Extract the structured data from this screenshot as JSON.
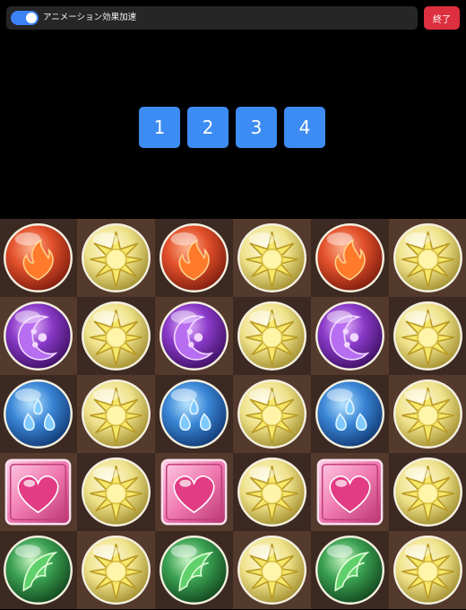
{
  "topbar": {
    "animation_toggle_label": "アニメーション効果加速",
    "animation_toggle_on": true,
    "end_button_label": "終了"
  },
  "combo_buttons": [
    "1",
    "2",
    "3",
    "4"
  ],
  "board": {
    "rows": 5,
    "cols": 6,
    "cell_colors": [
      "#3c2a22",
      "#54392d"
    ],
    "orbs": [
      [
        "fire",
        "light",
        "fire",
        "light",
        "fire",
        "light"
      ],
      [
        "dark",
        "light",
        "dark",
        "light",
        "dark",
        "light"
      ],
      [
        "water",
        "light",
        "water",
        "light",
        "water",
        "light"
      ],
      [
        "heart",
        "light",
        "heart",
        "light",
        "heart",
        "light"
      ],
      [
        "wood",
        "light",
        "wood",
        "light",
        "wood",
        "light"
      ]
    ]
  },
  "colors": {
    "accent_blue": "#3d8cf3",
    "end_red": "#dc2f3f",
    "fire": "#e2502b",
    "light": "#e8d85a",
    "dark": "#8a3ac8",
    "water": "#3a86d6",
    "heart": "#e85b9a",
    "wood": "#3aa051"
  }
}
